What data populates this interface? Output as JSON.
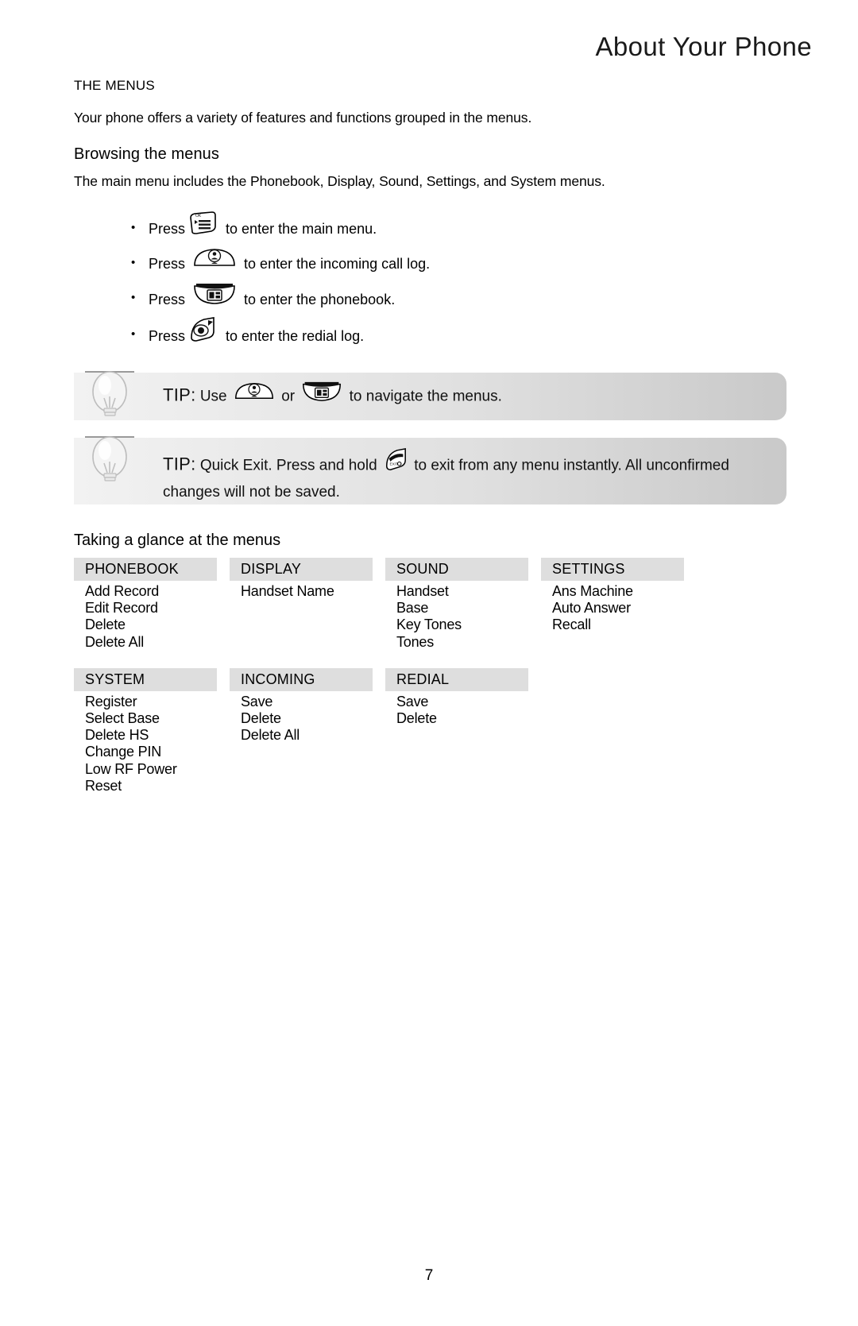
{
  "header": {
    "title": "About Your Phone"
  },
  "intro": {
    "section_label": "THE MENUS",
    "paragraph": "Your phone offers a variety of features and functions grouped in the menus.",
    "subhead": "Browsing the menus",
    "subhead_paragraph": "The main menu includes the Phonebook, Display, Sound, Settings, and System menus."
  },
  "bullets": [
    {
      "prefix": "Press",
      "icon": "menu-key-icon",
      "suffix": "to enter the main menu."
    },
    {
      "prefix": "Press",
      "icon": "up-arrow-incoming-call-key-icon",
      "suffix": "to enter the incoming call log."
    },
    {
      "prefix": "Press",
      "icon": "down-arrow-phonebook-key-icon",
      "suffix": "to enter the phonebook."
    },
    {
      "prefix": "Press",
      "icon": "redial-key-icon",
      "suffix": "to enter the redial log."
    }
  ],
  "tips": [
    {
      "label": "TIP:",
      "text_before": "Use",
      "icon_a": "up-arrow-incoming-call-key-icon",
      "text_middle": "or",
      "icon_b": "down-arrow-phonebook-key-icon",
      "text_after": "to navigate the menus."
    },
    {
      "label": "TIP:",
      "text_before": "Quick Exit. Press and hold",
      "icon_a": "exit-key-icon",
      "text_after": "to exit from any menu instantly. All unconfirmed changes will not be saved."
    }
  ],
  "glance": {
    "heading": "Taking a glance at the menus",
    "row_one": [
      {
        "title": "PHONEBOOK",
        "items": [
          "Add Record",
          "Edit Record",
          "Delete",
          "Delete All"
        ]
      },
      {
        "title": "DISPLAY",
        "items": [
          "Handset Name"
        ]
      },
      {
        "title": "SOUND",
        "items": [
          "Handset",
          "Base",
          "Key Tones",
          "Tones"
        ]
      },
      {
        "title": "SETTINGS",
        "items": [
          "Ans Machine",
          "Auto Answer",
          "Recall"
        ]
      }
    ],
    "row_two": [
      {
        "title": "SYSTEM",
        "items": [
          "Register",
          "Select Base",
          "Delete HS",
          "Change PIN",
          "Low RF Power",
          "Reset"
        ]
      },
      {
        "title": "INCOMING",
        "items": [
          "Save",
          "Delete",
          "Delete All"
        ]
      },
      {
        "title": "REDIAL",
        "items": [
          "Save",
          "Delete"
        ]
      }
    ]
  },
  "footer": {
    "page_number": "7"
  },
  "colors": {
    "menu_header_bg": "#dedede",
    "tip_bg_light": "#f2f2f2",
    "tip_bg_dark": "#c9c9c9",
    "text": "#000000"
  }
}
